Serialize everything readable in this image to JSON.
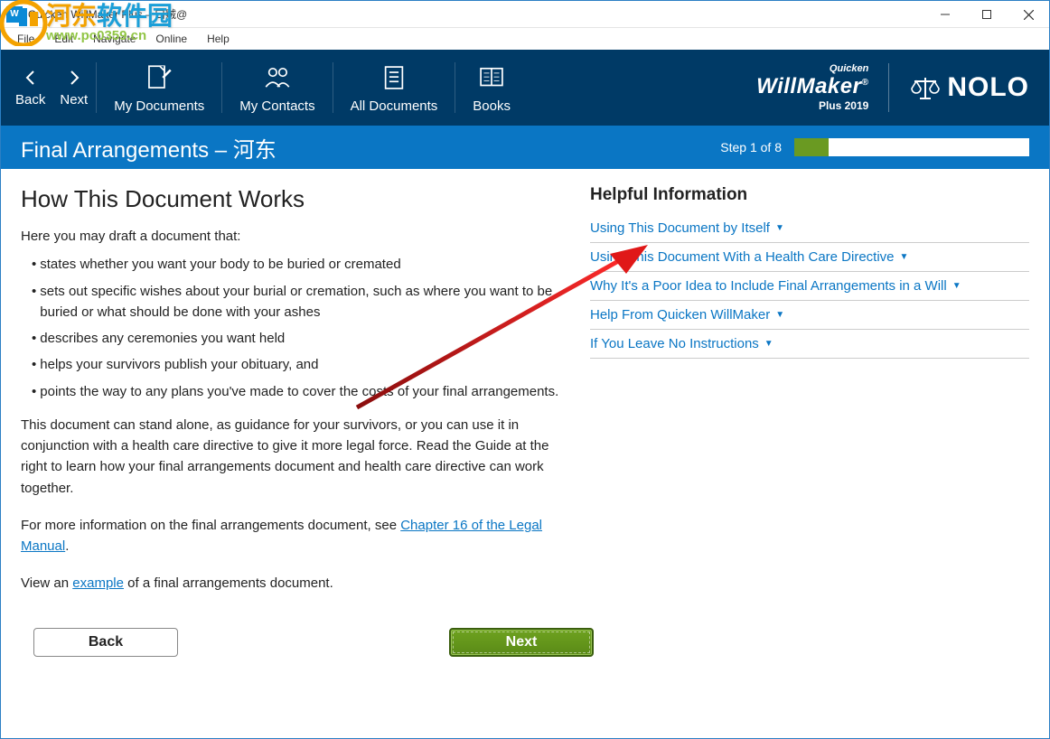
{
  "window": {
    "title": "Quicken WillMaker Plus – 口贼@"
  },
  "menu": {
    "file": "File",
    "edit": "Edit",
    "navigate": "Navigate",
    "online": "Online",
    "help": "Help"
  },
  "watermark": {
    "line1_a": "河东",
    "line1_b": "软件园",
    "line2": "www.pc0359.cn"
  },
  "toolbar": {
    "back": "Back",
    "next": "Next",
    "mydocs": "My Documents",
    "mycontacts": "My Contacts",
    "alldocs": "All Documents",
    "books": "Books"
  },
  "brand": {
    "quicken": "Quicken",
    "willmaker": "WillMaker",
    "plus": "Plus 2019",
    "nolo": "NOLO"
  },
  "subheader": {
    "title": "Final Arrangements – 河东",
    "step": "Step 1 of 8"
  },
  "page": {
    "heading": "How This Document Works",
    "intro": "Here you may draft a document that:",
    "bullets": [
      "states whether you want your body to be buried or cremated",
      "sets out specific wishes about your burial or cremation, such as where you want to be buried or what should be done with your ashes",
      "describes any ceremonies you want held",
      "helps your survivors publish your obituary, and",
      "points the way to any plans you've made to cover the costs of your final arrangements."
    ],
    "para1": "This document can stand alone, as guidance for your survivors, or you can use it in conjunction with a health care directive to give it more legal force. Read the Guide at the right to learn how your final arrangements document and health care directive can work together.",
    "para2_a": "For more information on the final arrangements document, see ",
    "para2_link": "Chapter 16 of the Legal Manual",
    "para2_b": ".",
    "para3_a": "View an ",
    "para3_link": "example",
    "para3_b": " of a final arrangements document."
  },
  "help": {
    "heading": "Helpful Information",
    "items": [
      "Using This Document by Itself",
      "Using This Document With a Health Care Directive",
      "Why It's a Poor Idea to Include Final Arrangements in a Will",
      "Help From Quicken WillMaker",
      "If You Leave No Instructions"
    ]
  },
  "buttons": {
    "back": "Back",
    "next": "Next"
  }
}
